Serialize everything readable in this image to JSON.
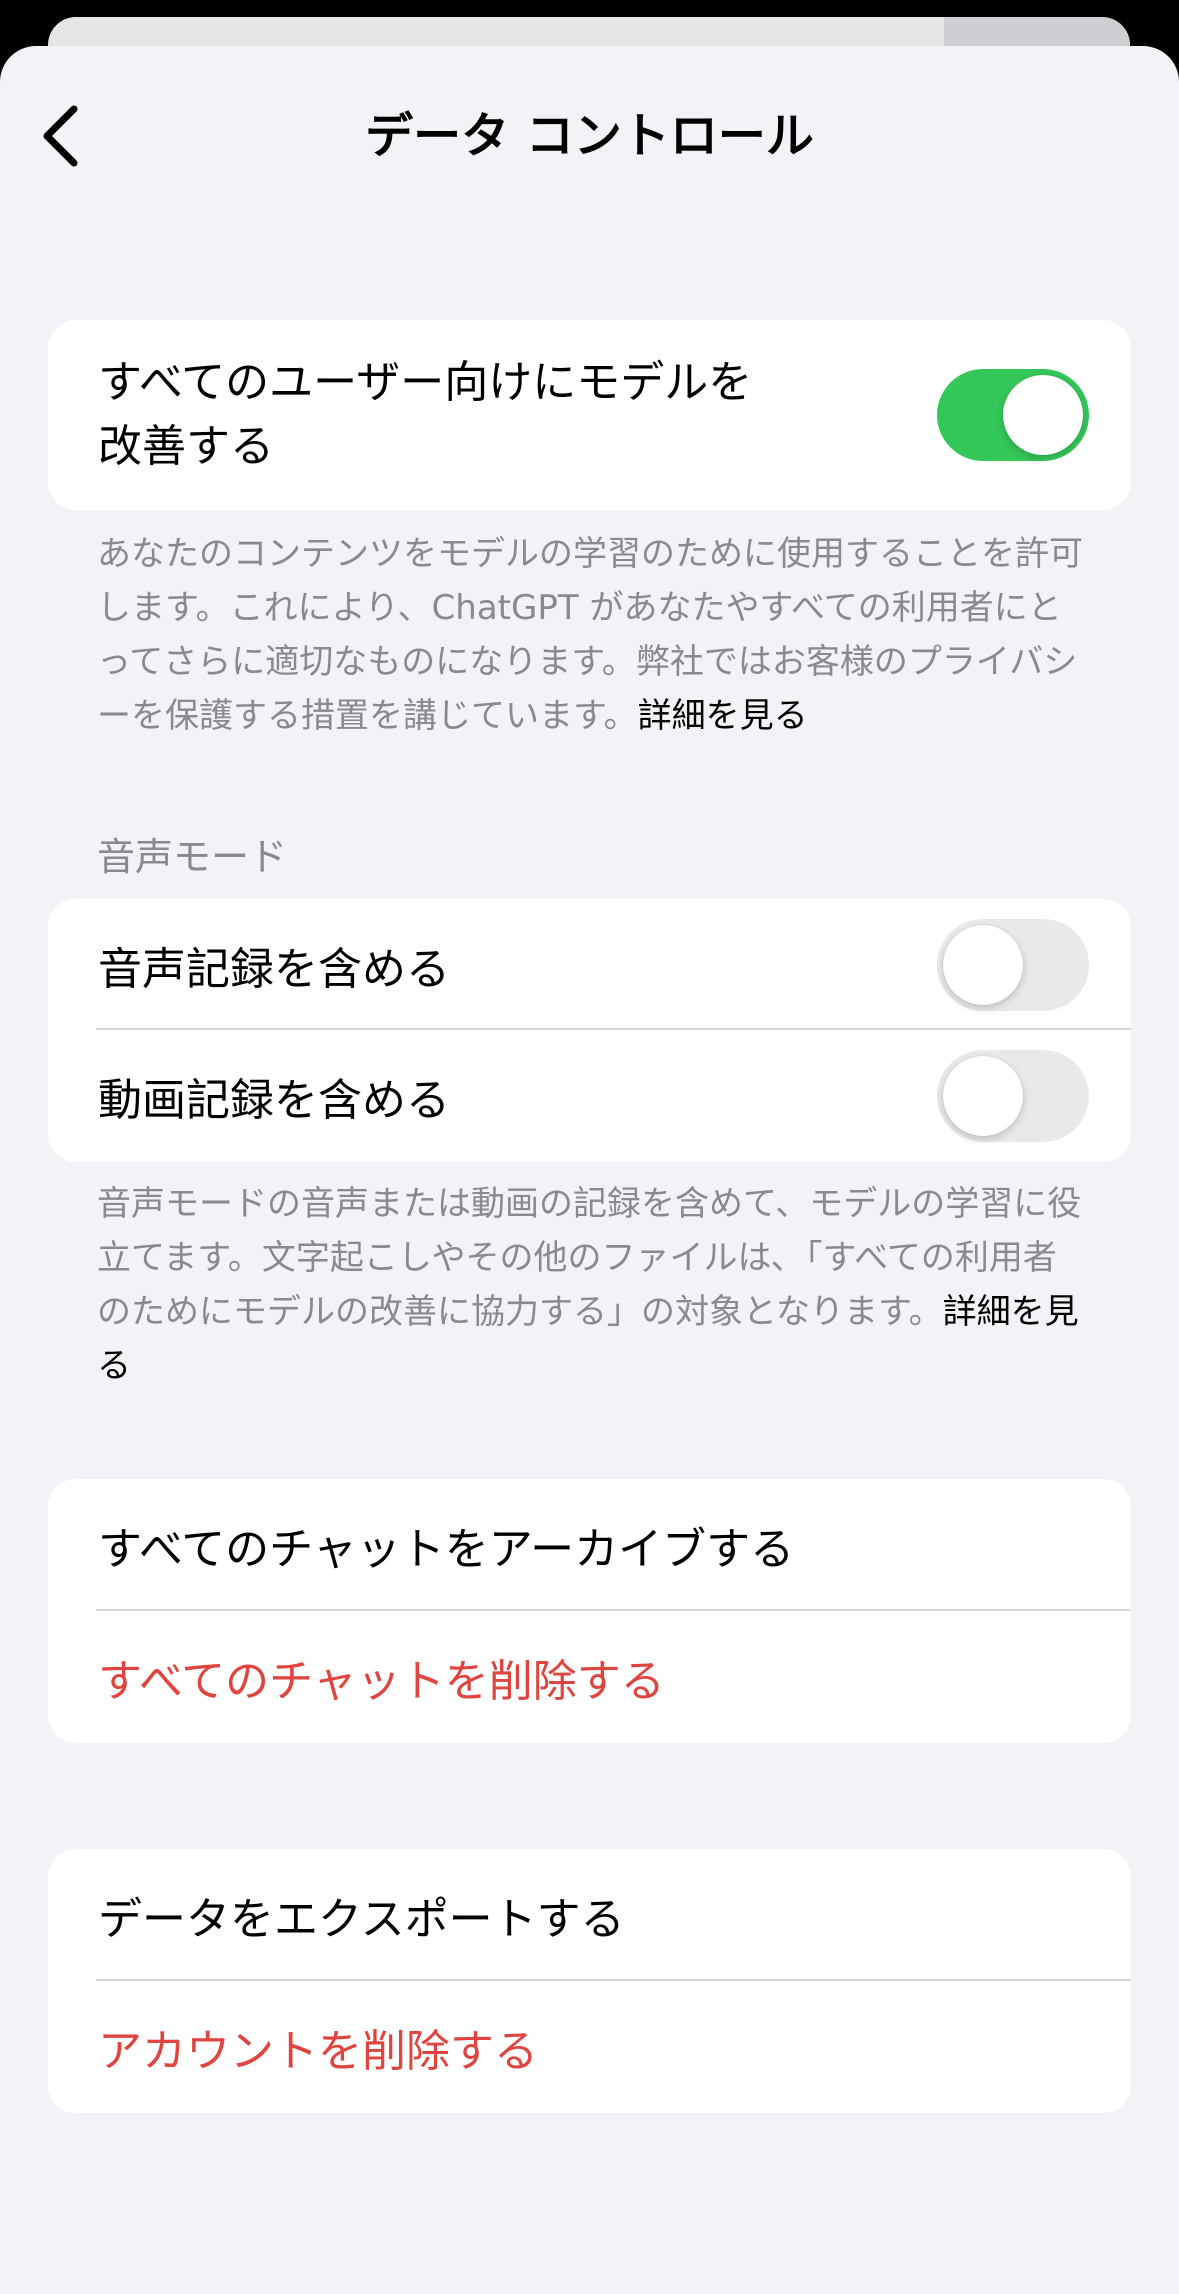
{
  "nav": {
    "title": "データ コントロール",
    "back_icon": "chevron-left-icon"
  },
  "improve_model": {
    "label_line1": "すべてのユーザー向けにモデルを",
    "label_line2": "改善する",
    "enabled": true,
    "footnote": "あなたのコンテンツをモデルの学習のために使用することを許可します。これにより、ChatGPT があなたやすべての利用者にとってさらに適切なものになります。弊社ではお客様のプライバシーを保護する措置を講じています。",
    "footnote_link": "詳細を見る"
  },
  "voice_mode": {
    "section_title": "音声モード",
    "items": [
      {
        "label": "音声記録を含める",
        "enabled": false
      },
      {
        "label": "動画記録を含める",
        "enabled": false
      }
    ],
    "footnote": "音声モードの音声または動画の記録を含めて、モデルの学習に役立てます。文字起こしやその他のファイルは､「すべての利用者のためにモデルの改善に協力する」の対象となります。",
    "footnote_link": "詳細を見る"
  },
  "chats": {
    "archive_label": "すべてのチャットをアーカイブする",
    "delete_label": "すべてのチャットを削除する"
  },
  "account": {
    "export_label": "データをエクスポートする",
    "delete_label": "アカウントを削除する"
  },
  "colors": {
    "toggle_on": "#34c759",
    "toggle_off": "#e9e9eb",
    "destructive": "#e0443e",
    "secondary_text": "#8a8a8e",
    "background": "#f2f2f7"
  }
}
